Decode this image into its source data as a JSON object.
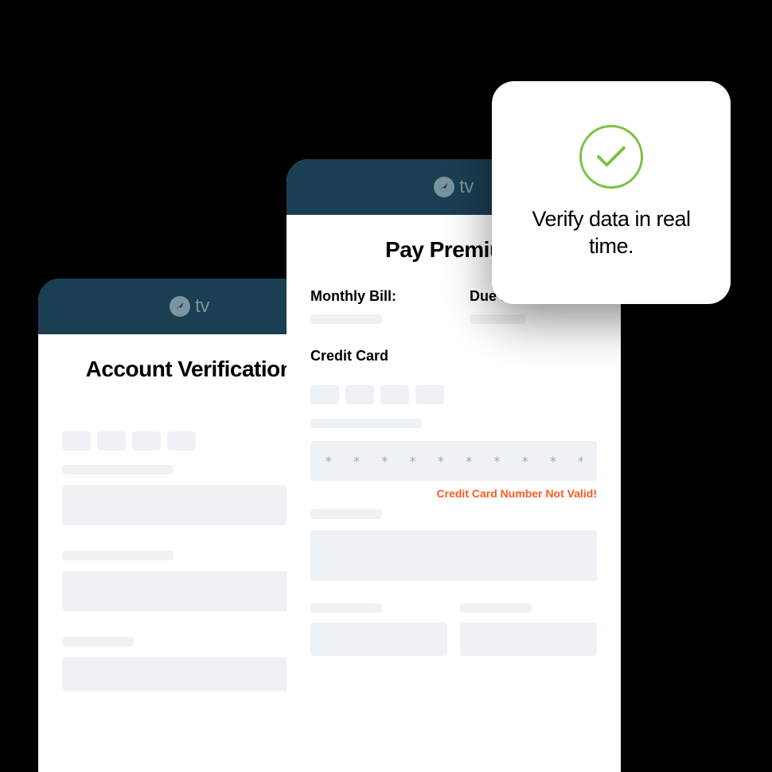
{
  "logo_text": "tv",
  "back_card": {
    "title": "Account Verification"
  },
  "front_card": {
    "title": "Pay Premium",
    "monthly_bill_label": "Monthly Bill:",
    "due_date_label": "Due Date:",
    "credit_card_label": "Credit Card",
    "cc_value": "* * * * * * * * * * * * * * * *",
    "error": "Credit Card Number Not Valid!"
  },
  "callout": {
    "text": "Verify data in real time."
  }
}
